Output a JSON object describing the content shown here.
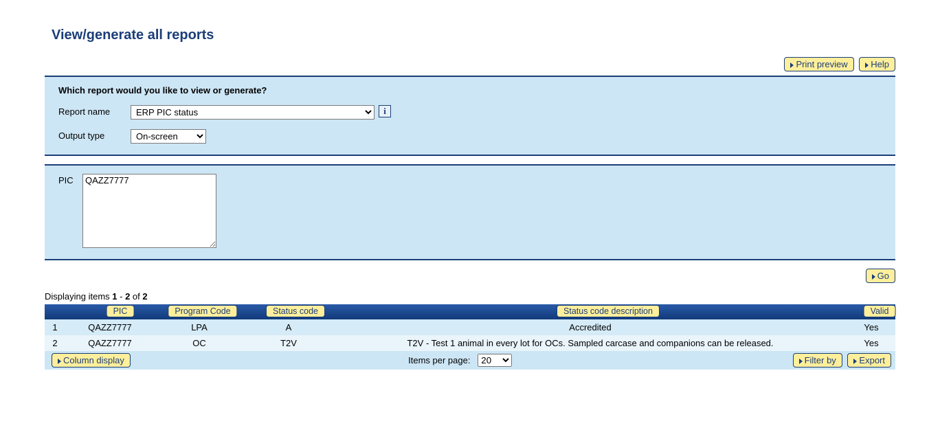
{
  "page_title": "View/generate all reports",
  "buttons": {
    "print_preview": "Print preview",
    "help": "Help",
    "go": "Go",
    "column_display": "Column display",
    "filter_by": "Filter by",
    "export": "Export"
  },
  "form": {
    "question": "Which report would you like to view or generate?",
    "report_name_label": "Report name",
    "report_name_value": "ERP PIC status",
    "output_type_label": "Output type",
    "output_type_value": "On-screen",
    "pic_label": "PIC",
    "pic_value": "QAZZ7777",
    "info_symbol": "i"
  },
  "results": {
    "display_prefix": "Displaying items ",
    "display_range_start": "1",
    "display_range_sep": " - ",
    "display_range_end": "2",
    "display_of": " of ",
    "display_total": "2",
    "columns": {
      "pic": "PIC",
      "program_code": "Program Code",
      "status_code": "Status code",
      "status_code_desc": "Status code description",
      "valid": "Valid"
    },
    "rows": [
      {
        "idx": "1",
        "pic": "QAZZ7777",
        "program_code": "LPA",
        "status_code": "A",
        "desc": "Accredited",
        "valid": "Yes"
      },
      {
        "idx": "2",
        "pic": "QAZZ7777",
        "program_code": "OC",
        "status_code": "T2V",
        "desc": "T2V - Test 1 animal in every lot for OCs. Sampled carcase and companions can be released.",
        "valid": "Yes"
      }
    ],
    "items_per_page_label": "Items per page:",
    "items_per_page_value": "20"
  }
}
